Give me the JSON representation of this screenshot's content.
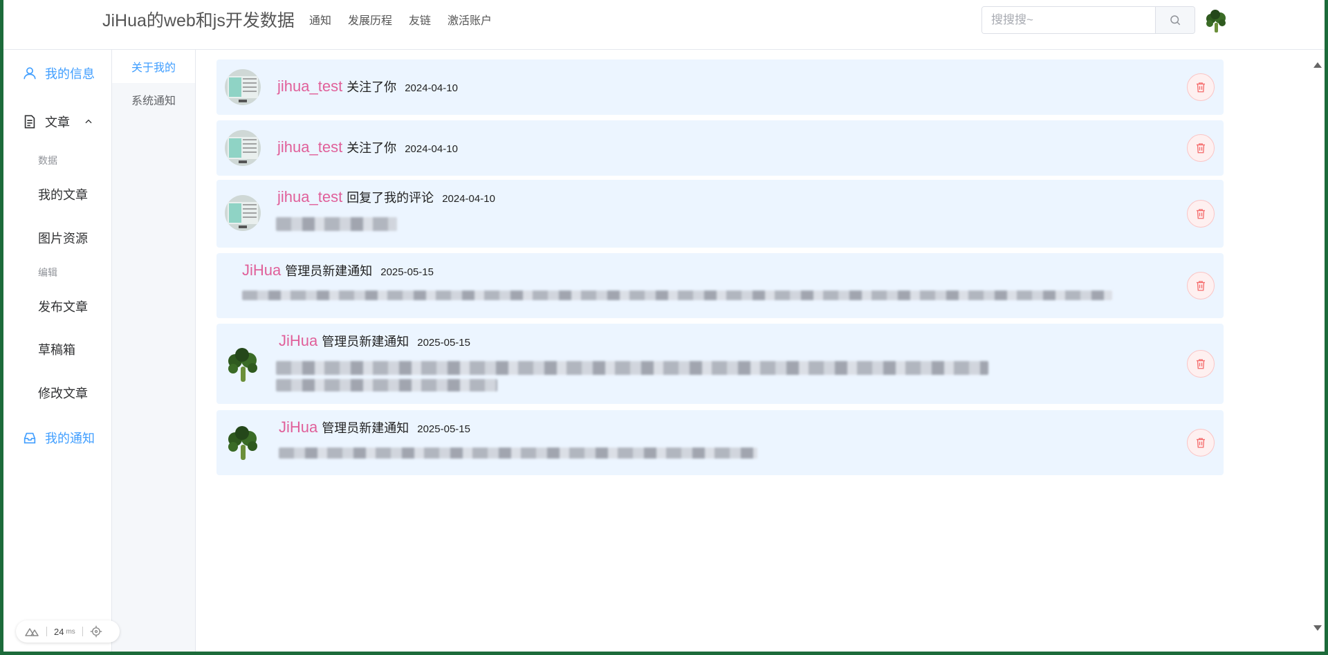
{
  "header": {
    "site_title": "JiHua的web和js开发数据",
    "nav": [
      "通知",
      "发展历程",
      "友链",
      "激活账户"
    ],
    "search_placeholder": "搜搜搜~"
  },
  "sidebar": {
    "my_info": "我的信息",
    "articles": "文章",
    "group_data": "数据",
    "my_articles": "我的文章",
    "image_resources": "图片资源",
    "group_edit": "编辑",
    "publish_article": "发布文章",
    "drafts": "草稿箱",
    "edit_article": "修改文章",
    "my_notifications": "我的通知"
  },
  "tabs": [
    "关于我的",
    "系统通知"
  ],
  "notifications": [
    {
      "user": "jihua_test",
      "action": "关注了你",
      "date": "2024-04-10"
    },
    {
      "user": "jihua_test",
      "action": "关注了你",
      "date": "2024-04-10"
    },
    {
      "user": "jihua_test",
      "action": "回复了我的评论",
      "date": "2024-04-10"
    },
    {
      "user": "JiHua",
      "action": "管理员新建通知",
      "date": "2025-05-15"
    },
    {
      "user": "JiHua",
      "action": "管理员新建通知",
      "date": "2025-05-15"
    },
    {
      "user": "JiHua",
      "action": "管理员新建通知",
      "date": "2025-05-15"
    }
  ],
  "perf": {
    "value": "24",
    "unit": "ms"
  },
  "colors": {
    "accent": "#409eff",
    "username": "#e0609a",
    "card_bg": "#ecf5ff",
    "danger": "#f56c6c"
  }
}
